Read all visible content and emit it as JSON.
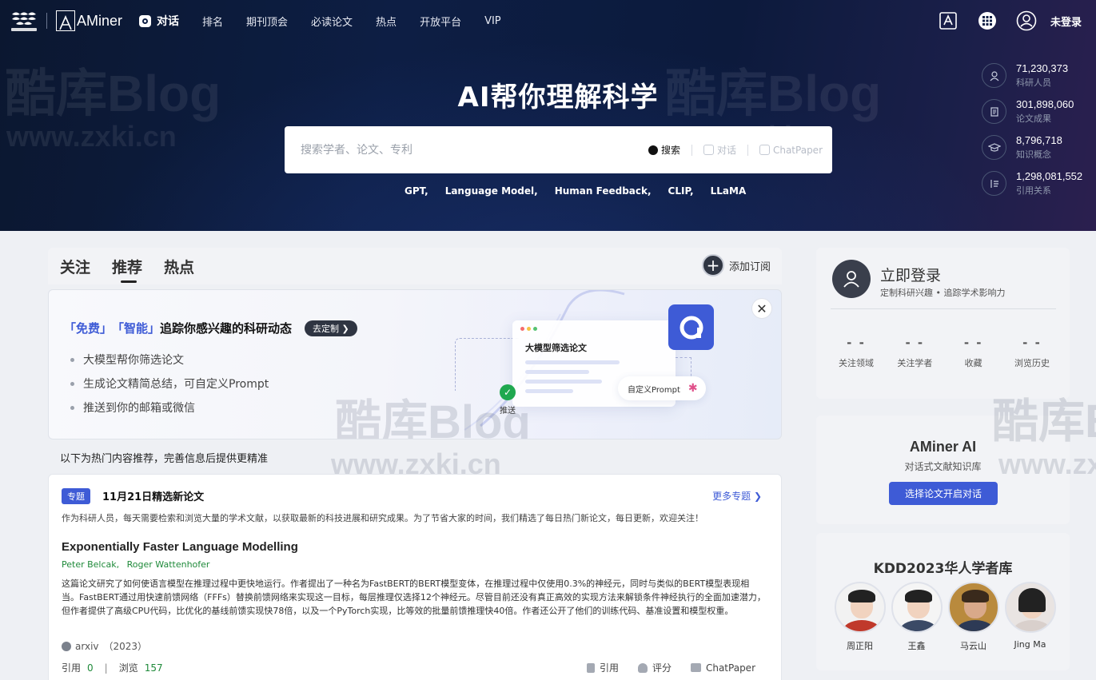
{
  "nav": {
    "logo_text": "AMiner",
    "items": [
      "对话",
      "排名",
      "期刊顶会",
      "必读论文",
      "热点",
      "开放平台",
      "VIP"
    ],
    "login": "未登录"
  },
  "hero": {
    "title": "AI帮你理解科学",
    "search_placeholder": "搜索学者、论文、专利",
    "search_label": "搜索",
    "chat_label": "对话",
    "chatpaper_label": "ChatPaper",
    "keywords": [
      "GPT,",
      "Language Model,",
      "Human Feedback,",
      "CLIP,",
      "LLaMA"
    ]
  },
  "stats": [
    {
      "num": "71,230,373",
      "label": "科研人员"
    },
    {
      "num": "301,898,060",
      "label": "论文成果"
    },
    {
      "num": "8,796,718",
      "label": "知识概念"
    },
    {
      "num": "1,298,081,552",
      "label": "引用关系"
    }
  ],
  "feed": {
    "tabs": [
      "关注",
      "推荐",
      "热点"
    ],
    "subscribe": "添加订阅",
    "hint": "以下为热门内容推荐，完善信息后提供更精准"
  },
  "banner": {
    "hl1": "「免费」",
    "hl2": "「智能」",
    "title_rest": "追踪你感兴趣的科研动态",
    "customize": "去定制",
    "bullets": [
      "大模型帮你筛选论文",
      "生成论文精简总结，可自定义Prompt",
      "推送到你的邮箱或微信"
    ],
    "card_title": "大模型筛选论文",
    "prompt_chip": "自定义Prompt",
    "push": "推送"
  },
  "topic": {
    "tag": "专题",
    "title": "11月21日精选新论文",
    "more": "更多专题",
    "desc": "作为科研人员，每天需要检索和浏览大量的学术文献，以获取最新的科技进展和研究成果。为了节省大家的时间，我们精选了每日热门新论文，每日更新，欢迎关注！"
  },
  "paper": {
    "title": "Exponentially Faster Language Modelling",
    "authors": [
      "Peter Belcak,",
      "Roger Wattenhofer"
    ],
    "abstract": "这篇论文研究了如何使语言模型在推理过程中更快地运行。作者提出了一种名为FastBERT的BERT模型变体，在推理过程中仅使用0.3%的神经元，同时与类似的BERT模型表现相当。FastBERT通过用快速前馈网络（FFFs）替换前馈网络来实现这一目标，每层推理仅选择12个神经元。尽管目前还没有真正高效的实现方法来解锁条件神经执行的全面加速潜力，但作者提供了高级CPU代码，比优化的基线前馈实现快78倍，以及一个PyTorch实现，比等效的批量前馈推理快40倍。作者还公开了他们的训练代码、基准设置和模型权重。",
    "venue": "arxiv",
    "year": "（2023）",
    "cite_label": "引用",
    "cite_count": "0",
    "view_label": "浏览",
    "view_count": "157",
    "action_cite": "引用",
    "action_rate": "评分",
    "action_chatpaper": "ChatPaper"
  },
  "side": {
    "login_title": "立即登录",
    "login_sub": "定制科研兴趣 • 追踪学术影响力",
    "stats": [
      {
        "val": "- -",
        "label": "关注领域"
      },
      {
        "val": "- -",
        "label": "关注学者"
      },
      {
        "val": "- -",
        "label": "收藏"
      },
      {
        "val": "- -",
        "label": "浏览历史"
      }
    ],
    "ai_title": "AMiner AI",
    "ai_sub": "对话式文献知识库",
    "ai_btn": "选择论文开启对话",
    "kdd_title": "KDD2023华人学者库",
    "scholars": [
      "周正阳",
      "王鑫",
      "马云山",
      "Jing Ma"
    ]
  },
  "watermarks": [
    "酷库Blog",
    "www.zxki.cn"
  ],
  "colors": {
    "accent": "#3e5bd6",
    "green": "#1f8a3a",
    "hero_bg": "#0d1e44"
  }
}
